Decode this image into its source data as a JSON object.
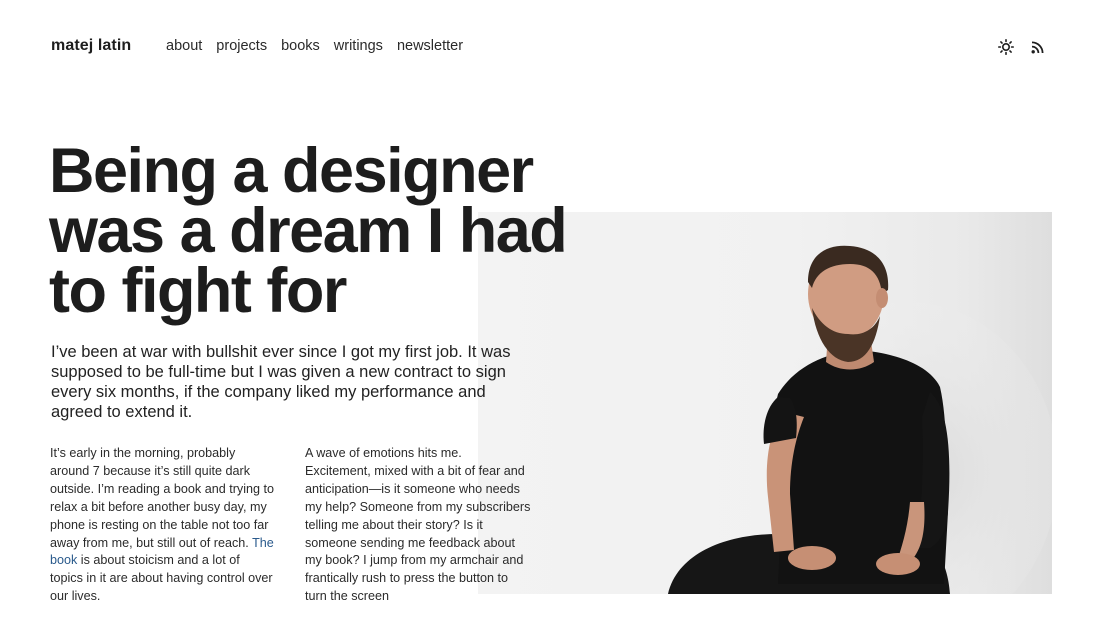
{
  "brand": "matej latin",
  "nav": [
    {
      "label": "about"
    },
    {
      "label": "projects"
    },
    {
      "label": "books"
    },
    {
      "label": "writings"
    },
    {
      "label": "newsletter"
    }
  ],
  "header_icons": {
    "theme": "sun-icon",
    "feed": "rss-icon"
  },
  "hero": {
    "headline_lines": [
      "Being a designer",
      "was a dream I had",
      "to fight for"
    ],
    "lead": "I’ve been at war with bullshit ever since I got my first job. It was supposed to be full-time but I was given a new contract to sign every six months, if the company liked my performance and agreed to extend it."
  },
  "body": {
    "col1_before": "It’s early in the morning, probably around 7 because it’s still quite dark outside. I’m reading a book and trying to relax a bit before another busy day, my phone is resting on the table not too far away from me, but still out of reach. ",
    "col1_link": "The book",
    "col1_after": " is about stoicism and a lot of topics in it are about having control over our lives.",
    "col2": "A wave of emotions hits me. Excitement, mixed with a bit of fear and anticipation—is it someone who needs my help? Someone from my subscribers telling me about their story? Is it someone sending me feedback about my book? I jump from my armchair and frantically rush to press the button to turn the screen"
  },
  "colors": {
    "text": "#1d1d1d",
    "link": "#2a5a8c",
    "photo_bg": "#f2f2f2"
  }
}
